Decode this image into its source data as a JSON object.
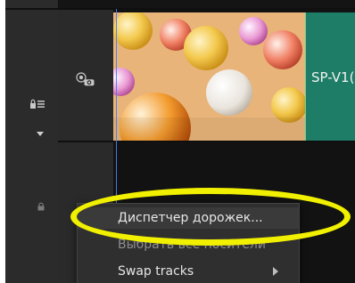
{
  "clip": {
    "label": "SP-V1("
  },
  "context_menu": {
    "items": [
      {
        "label": "Диспетчер дорожек..."
      },
      {
        "label": "Выбрать все носители"
      },
      {
        "label": "Swap tracks"
      }
    ]
  },
  "colors": {
    "annotation_ring": "#f1f000",
    "clip_green": "#1e7d66",
    "playhead": "#4a7eea"
  },
  "icons": {
    "visibility": "eye-icon",
    "lock_list": "lock-list-icon",
    "collapse": "chevron-down-icon",
    "lock": "lock-icon"
  }
}
